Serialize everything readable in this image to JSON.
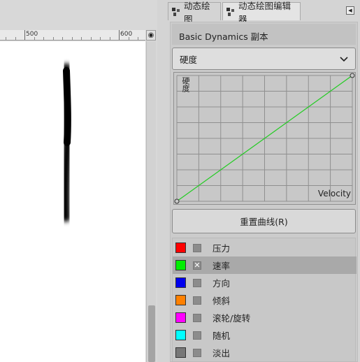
{
  "ruler": {
    "labels": [
      "500",
      "600"
    ]
  },
  "tabs": [
    {
      "label": "动态绘图",
      "active": false
    },
    {
      "label": "动态绘图编辑器",
      "active": true
    }
  ],
  "editor": {
    "dynamics_name": "Basic Dynamics 副本",
    "selected_output": "硬度",
    "curve": {
      "ylabel": "硬度",
      "xlabel": "Velocity",
      "points": [
        [
          0,
          0
        ],
        [
          1,
          1
        ]
      ],
      "line_color": "#22cc22"
    },
    "reset_label": "重置曲线(R)"
  },
  "inputs": [
    {
      "label": "压力",
      "color": "#ff0000",
      "checked": false
    },
    {
      "label": "速率",
      "color": "#00ee00",
      "checked": true
    },
    {
      "label": "方向",
      "color": "#0000ee",
      "checked": false
    },
    {
      "label": "倾斜",
      "color": "#ff8000",
      "checked": false
    },
    {
      "label": "滚轮/旋转",
      "color": "#ff00ff",
      "checked": false
    },
    {
      "label": "随机",
      "color": "#00ffff",
      "checked": false
    },
    {
      "label": "淡出",
      "color": "#777777",
      "checked": false
    }
  ],
  "icons": {
    "nav": "navigate-icon",
    "dock_menu": "dock-menu-icon",
    "select_arrow": "chevron-down-icon",
    "checkmark": "x-check-icon"
  }
}
